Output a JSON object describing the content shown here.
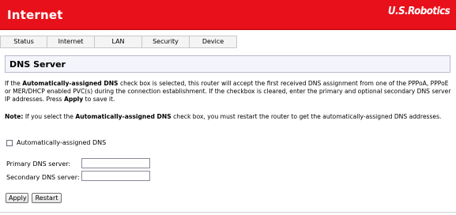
{
  "header": {
    "title": "Internet",
    "brand": "U.S.Robotics"
  },
  "tabs": [
    {
      "label": "Status"
    },
    {
      "label": "Internet"
    },
    {
      "label": "LAN"
    },
    {
      "label": "Security"
    },
    {
      "label": "Device"
    }
  ],
  "panel": {
    "title": "DNS Server"
  },
  "description": {
    "p1": "If the",
    "p1_bold": "Automatically-assigned DNS",
    "p2": "check box is selected, this router will accept the first received DNS assignment from one of the PPPoA, PPPoE or MER/DHCP enabled PVC(s) during the connection establishment. If the checkbox is cleared, enter the primary and optional secondary DNS server IP addresses. Press",
    "p2_bold": "Apply",
    "p3": "to save it."
  },
  "note": {
    "label": "Note:",
    "p1": "If you select the",
    "p1_bold": "Automatically-assigned DNS",
    "p2": "check box, you must restart the router to get the automatically-assigned DNS addresses."
  },
  "form": {
    "auto_dns_label": "Automatically-assigned DNS",
    "auto_dns_checked": false,
    "primary_label": "Primary DNS server:",
    "primary_value": "",
    "secondary_label": "Secondary DNS server:",
    "secondary_value": ""
  },
  "buttons": {
    "apply": "Apply",
    "restart": "Restart"
  },
  "colors": {
    "header_red": "#e8101a",
    "panel_bg": "#f4f5fb"
  }
}
